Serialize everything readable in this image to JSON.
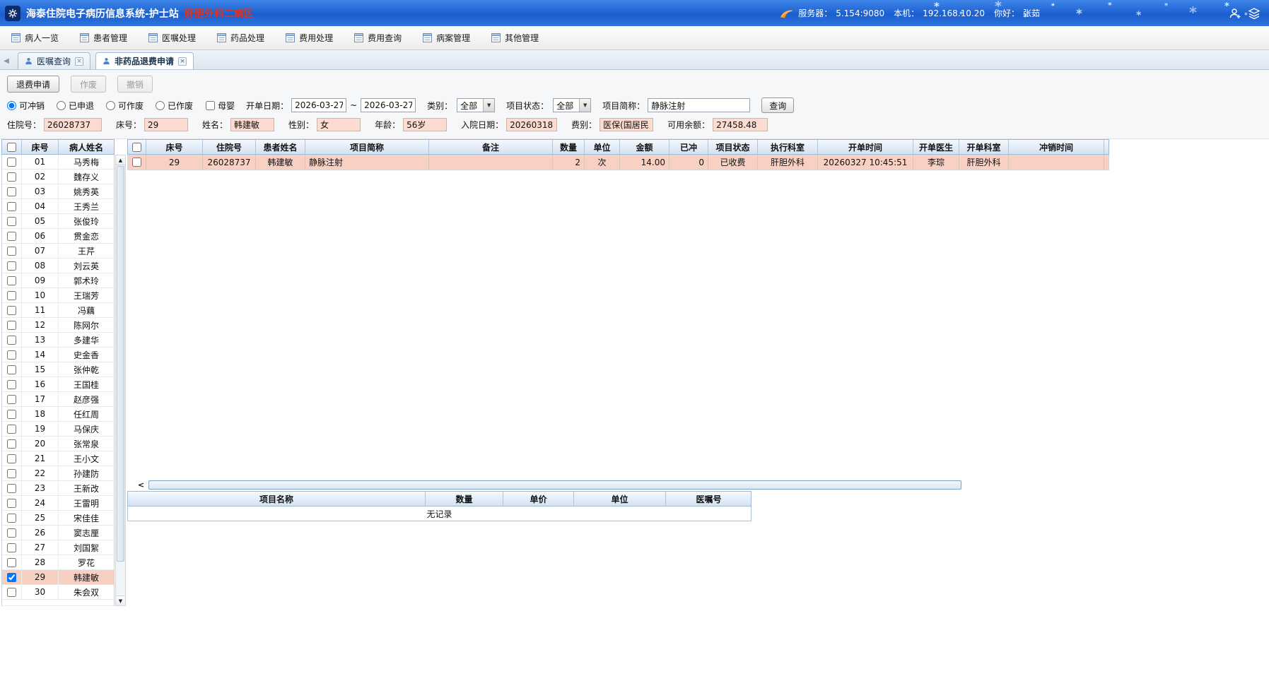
{
  "titlebar": {
    "app_title": "海泰住院电子病历信息系统-护士站",
    "ward": "肝胆外科二病区",
    "server_label": "服务器：",
    "server_value": "5.154:9080",
    "host_label": "本机：",
    "host_value": "192.168.10.20",
    "greeting_label": "你好：",
    "greeting_value": "张茹"
  },
  "menubar": {
    "items": [
      "病人一览",
      "患者管理",
      "医嘱处理",
      "药品处理",
      "费用处理",
      "费用查询",
      "病案管理",
      "其他管理"
    ]
  },
  "tabbar": {
    "tabs": [
      {
        "label": "医嘱查询"
      },
      {
        "label": "非药品退费申请"
      }
    ]
  },
  "actions": {
    "refund_label": "退费申请",
    "void_label": "作废",
    "revoke_label": "撤销"
  },
  "filters": {
    "radio_options": [
      {
        "label": "可冲销",
        "checked": true
      },
      {
        "label": "已申退",
        "checked": false
      },
      {
        "label": "可作废",
        "checked": false
      },
      {
        "label": "已作废",
        "checked": false
      }
    ],
    "mother_baby": "母婴",
    "date_label": "开单日期：",
    "date_from": "2026-03-27",
    "date_separator": "~",
    "date_to": "2026-03-27",
    "category_label": "类别：",
    "category_value": "全部",
    "status_label": "项目状态：",
    "status_value": "全部",
    "item_label": "项目简称：",
    "item_value": "静脉注射",
    "query_label": "查询"
  },
  "patient_info": {
    "fields": [
      {
        "label": "住院号：",
        "value": "26028737"
      },
      {
        "label": "床号：",
        "value": "29"
      },
      {
        "label": "姓名：",
        "value": "韩建敏"
      },
      {
        "label": "性别：",
        "value": "女"
      },
      {
        "label": "年龄：",
        "value": "56岁"
      },
      {
        "label": "入院日期：",
        "value": "20260318"
      },
      {
        "label": "费别：",
        "value": "医保(国居民"
      },
      {
        "label": "可用余额：",
        "value": "27458.48"
      }
    ]
  },
  "patient_list": {
    "headers": [
      "床号",
      "病人姓名"
    ],
    "rows": [
      {
        "bed": "01",
        "name": "马秀梅",
        "selected": false,
        "checked": false
      },
      {
        "bed": "02",
        "name": "魏存义",
        "selected": false,
        "checked": false
      },
      {
        "bed": "03",
        "name": "姚秀英",
        "selected": false,
        "checked": false
      },
      {
        "bed": "04",
        "name": "王秀兰",
        "selected": false,
        "checked": false
      },
      {
        "bed": "05",
        "name": "张俊玲",
        "selected": false,
        "checked": false
      },
      {
        "bed": "06",
        "name": "贯金恋",
        "selected": false,
        "checked": false
      },
      {
        "bed": "07",
        "name": "王芹",
        "selected": false,
        "checked": false
      },
      {
        "bed": "08",
        "name": "刘云英",
        "selected": false,
        "checked": false
      },
      {
        "bed": "09",
        "name": "郭术玲",
        "selected": false,
        "checked": false
      },
      {
        "bed": "10",
        "name": "王瑞芳",
        "selected": false,
        "checked": false
      },
      {
        "bed": "11",
        "name": "冯藕",
        "selected": false,
        "checked": false
      },
      {
        "bed": "12",
        "name": "陈网尔",
        "selected": false,
        "checked": false
      },
      {
        "bed": "13",
        "name": "多建华",
        "selected": false,
        "checked": false
      },
      {
        "bed": "14",
        "name": "史金香",
        "selected": false,
        "checked": false
      },
      {
        "bed": "15",
        "name": "张仲乾",
        "selected": false,
        "checked": false
      },
      {
        "bed": "16",
        "name": "王国桂",
        "selected": false,
        "checked": false
      },
      {
        "bed": "17",
        "name": "赵彦强",
        "selected": false,
        "checked": false
      },
      {
        "bed": "18",
        "name": "任红周",
        "selected": false,
        "checked": false
      },
      {
        "bed": "19",
        "name": "马保庆",
        "selected": false,
        "checked": false
      },
      {
        "bed": "20",
        "name": "张常泉",
        "selected": false,
        "checked": false
      },
      {
        "bed": "21",
        "name": "王小文",
        "selected": false,
        "checked": false
      },
      {
        "bed": "22",
        "name": "孙建防",
        "selected": false,
        "checked": false
      },
      {
        "bed": "23",
        "name": "王新改",
        "selected": false,
        "checked": false
      },
      {
        "bed": "24",
        "name": "王雷明",
        "selected": false,
        "checked": false
      },
      {
        "bed": "25",
        "name": "宋佳佳",
        "selected": false,
        "checked": false
      },
      {
        "bed": "26",
        "name": "窦志厘",
        "selected": false,
        "checked": false
      },
      {
        "bed": "27",
        "name": "刘国絮",
        "selected": false,
        "checked": false
      },
      {
        "bed": "28",
        "name": "罗花",
        "selected": false,
        "checked": false
      },
      {
        "bed": "29",
        "name": "韩建敏",
        "selected": true,
        "checked": true
      },
      {
        "bed": "30",
        "name": "朱会双",
        "selected": false,
        "checked": false
      }
    ]
  },
  "main_table": {
    "headers": [
      "床号",
      "住院号",
      "患者姓名",
      "项目简称",
      "备注",
      "数量",
      "单位",
      "金额",
      "已冲",
      "项目状态",
      "执行科室",
      "开单时间",
      "开单医生",
      "开单科室",
      "冲销时间"
    ],
    "rows": [
      {
        "bed": "29",
        "admission_no": "26028737",
        "patient_name": "韩建敏",
        "item_name": "静脉注射",
        "remark": "",
        "quantity": "2",
        "unit": "次",
        "amount": "14.00",
        "offset_qty": "0",
        "item_status": "已收费",
        "exec_dept": "肝胆外科",
        "order_time": "20260327 10:45:51",
        "order_doctor": "李琮",
        "order_dept": "肝胆外科",
        "offset_time": ""
      }
    ]
  },
  "detail_table": {
    "headers": [
      "项目名称",
      "数量",
      "单价",
      "单位",
      "医嘱号"
    ],
    "empty_text": "无记录"
  },
  "icons": {
    "dropdown": "▼",
    "close_tab": "×",
    "tab_back": "◀",
    "scroll_up": "▲",
    "scroll_down": "▼",
    "scroll_left": "<"
  }
}
